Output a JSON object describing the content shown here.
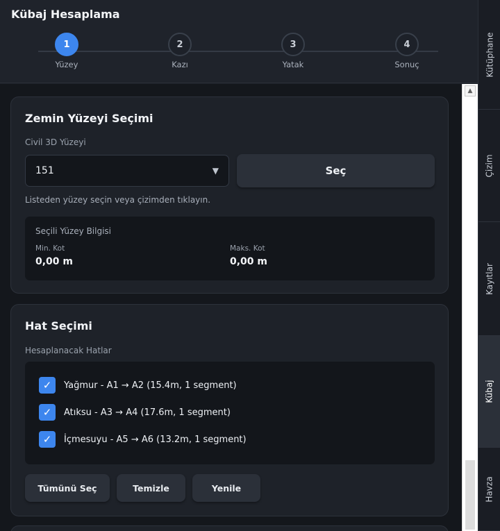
{
  "app": {
    "title": "Kübaj Hesaplama"
  },
  "steps": [
    {
      "number": "1",
      "label": "Yüzey",
      "active": true
    },
    {
      "number": "2",
      "label": "Kazı",
      "active": false
    },
    {
      "number": "3",
      "label": "Yatak",
      "active": false
    },
    {
      "number": "4",
      "label": "Sonuç",
      "active": false
    }
  ],
  "surface": {
    "title": "Zemin Yüzeyi Seçimi",
    "field_label": "Civil 3D Yüzeyi",
    "selected": "151",
    "select_button": "Seç",
    "hint": "Listeden yüzey seçin veya çizimden tıklayın.",
    "info": {
      "title": "Seçili Yüzey Bilgisi",
      "min_label": "Min. Kot",
      "min_value": "0,00 m",
      "max_label": "Maks. Kot",
      "max_value": "0,00 m"
    }
  },
  "lines": {
    "title": "Hat Seçimi",
    "field_label": "Hesaplanacak Hatlar",
    "items": [
      {
        "label": "Yağmur - A1 → A2 (15.4m, 1 segment)",
        "checked": true
      },
      {
        "label": "Atıksu - A3 → A4 (17.6m, 1 segment)",
        "checked": true
      },
      {
        "label": "İçmesuyu - A5 → A6 (13.2m, 1 segment)",
        "checked": true
      }
    ],
    "buttons": {
      "select_all": "Tümünü Seç",
      "clear": "Temizle",
      "refresh": "Yenile"
    }
  },
  "side_tabs": [
    {
      "label": "Kütüphane",
      "active": false
    },
    {
      "label": "Çizim",
      "active": false
    },
    {
      "label": "Kayıtlar",
      "active": false
    },
    {
      "label": "Kübaj",
      "active": true
    },
    {
      "label": "Havza",
      "active": false
    }
  ],
  "icons": {
    "dropdown": "triangle-down-icon",
    "scroll_up": "chevron-up-icon",
    "check": "check-icon"
  },
  "colors": {
    "accent": "#3d86ee",
    "background": "#14171c",
    "card": "#1e2229"
  }
}
